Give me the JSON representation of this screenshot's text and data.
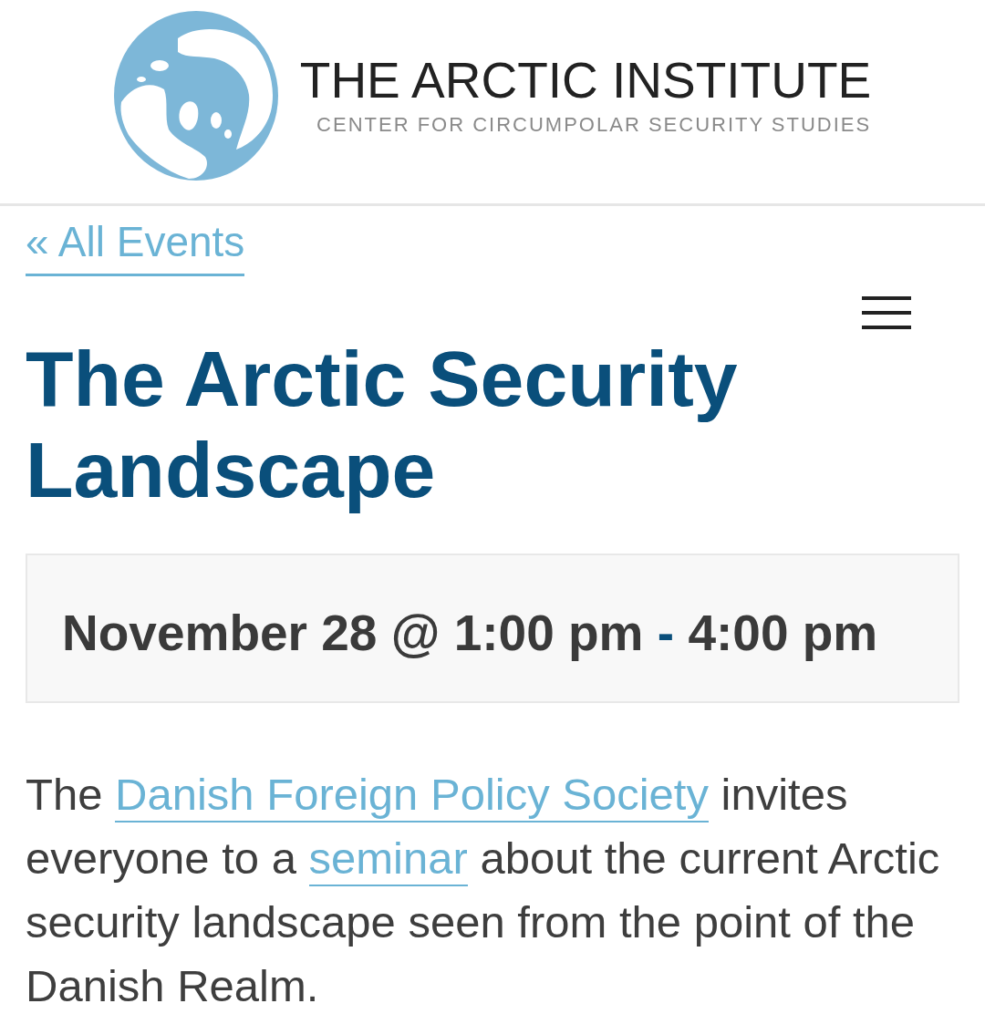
{
  "header": {
    "site_title": "THE ARCTIC INSTITUTE",
    "site_tagline": "CENTER FOR CIRCUMPOLAR SECURITY STUDIES"
  },
  "back_link": "« All Events",
  "title": "The Arctic Security Landscape",
  "schedule": {
    "start": "November 28 @ 1:00 pm",
    "separator": "-",
    "end": "4:00 pm"
  },
  "description": [
    {
      "kind": "text",
      "text": "The "
    },
    {
      "kind": "link",
      "text": "Danish Foreign Policy Society"
    },
    {
      "kind": "text",
      "text": " invites everyone to a "
    },
    {
      "kind": "link",
      "text": "seminar"
    },
    {
      "kind": "text",
      "text": " about the current Arctic security landscape seen from the point of the Danish Realm."
    }
  ]
}
